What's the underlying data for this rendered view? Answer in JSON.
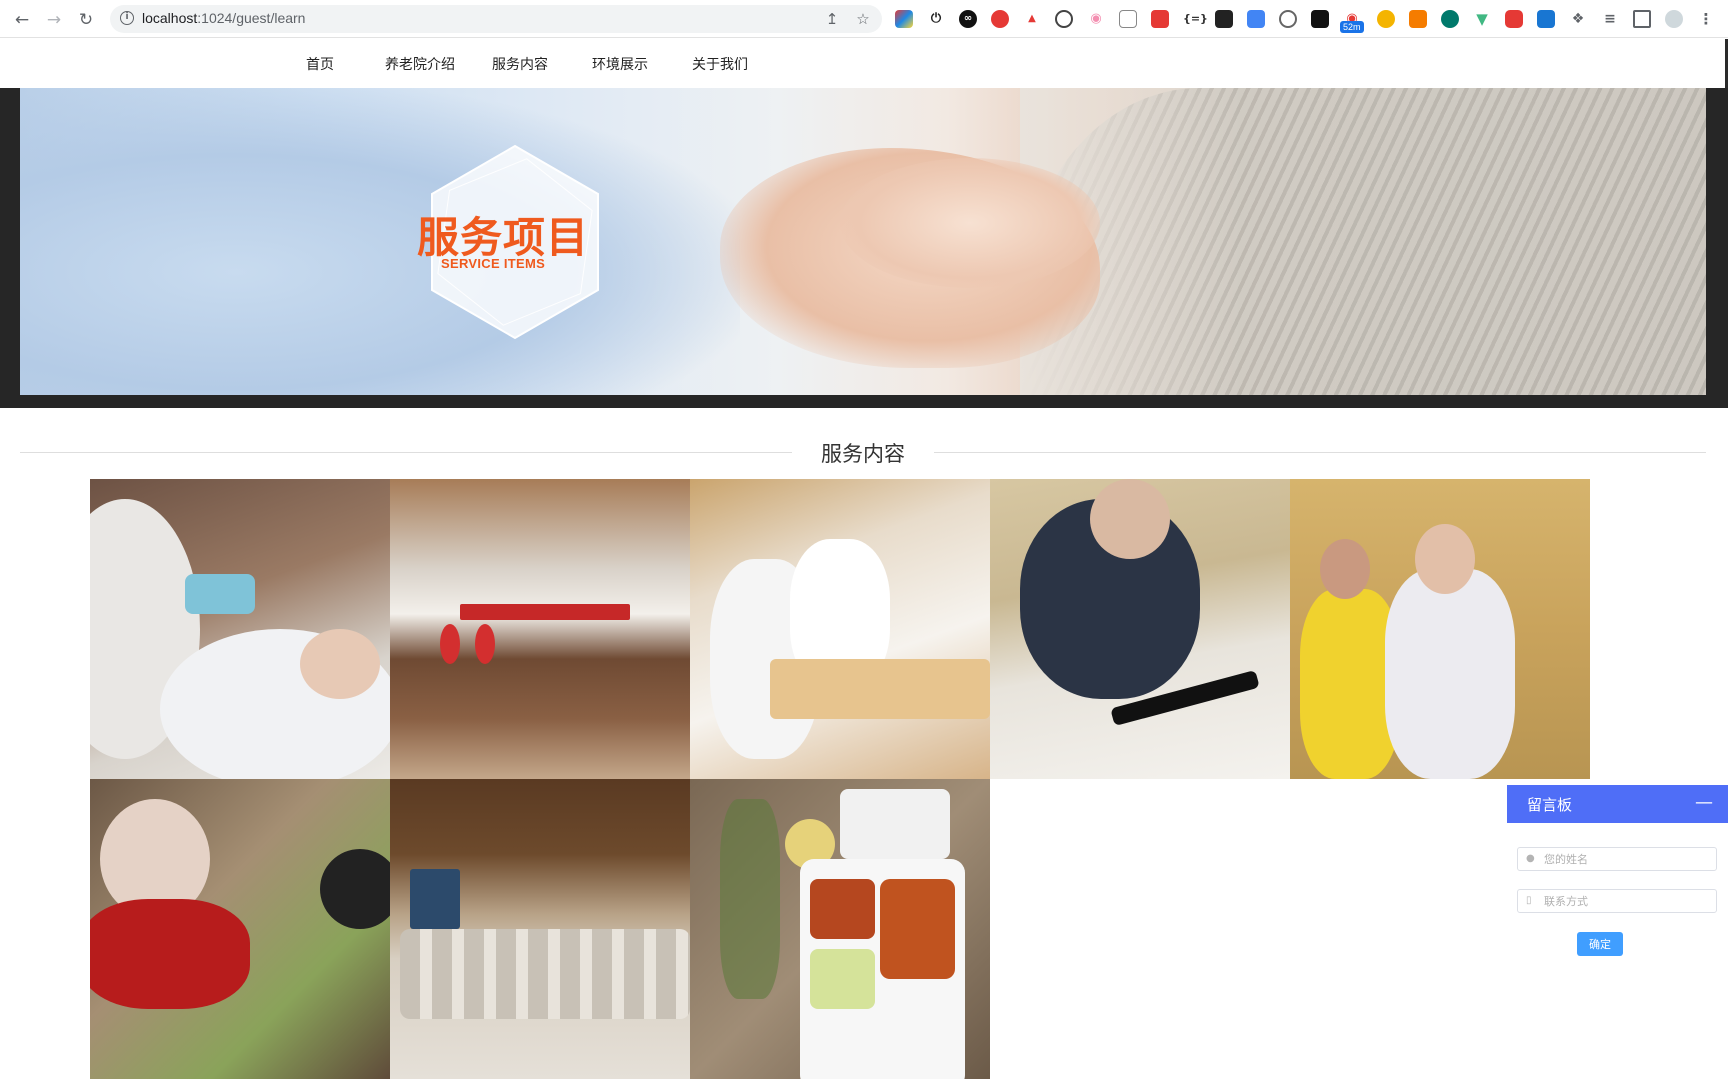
{
  "browser": {
    "url_host": "localhost",
    "url_rest": ":1024/guest/learn",
    "extension_badge": "52m"
  },
  "nav": {
    "items": [
      "首页",
      "养老院介绍",
      "服务内容",
      "环境展示",
      "关于我们"
    ]
  },
  "banner": {
    "title": "服务项目",
    "subtitle": "SERVICE ITEMS",
    "title_color": "#ef5a1e"
  },
  "section": {
    "title": "服务内容"
  },
  "gallery": {
    "photos": [
      {
        "name": "nurse-blood-pressure-photo"
      },
      {
        "name": "reception-desk-photo"
      },
      {
        "name": "doctor-with-elder-photo"
      },
      {
        "name": "calligraphy-photo"
      },
      {
        "name": "caregiver-with-elder-photo"
      },
      {
        "name": "elderly-woman-photo"
      },
      {
        "name": "lecture-hall-photo"
      },
      {
        "name": "meal-tray-photo"
      }
    ]
  },
  "message_board": {
    "title": "留言板",
    "minimize_symbol": "—",
    "name_placeholder": "您的姓名",
    "contact_placeholder": "联系方式",
    "submit_label": "确定",
    "header_color": "#4f6ef7",
    "button_color": "#409eff"
  }
}
